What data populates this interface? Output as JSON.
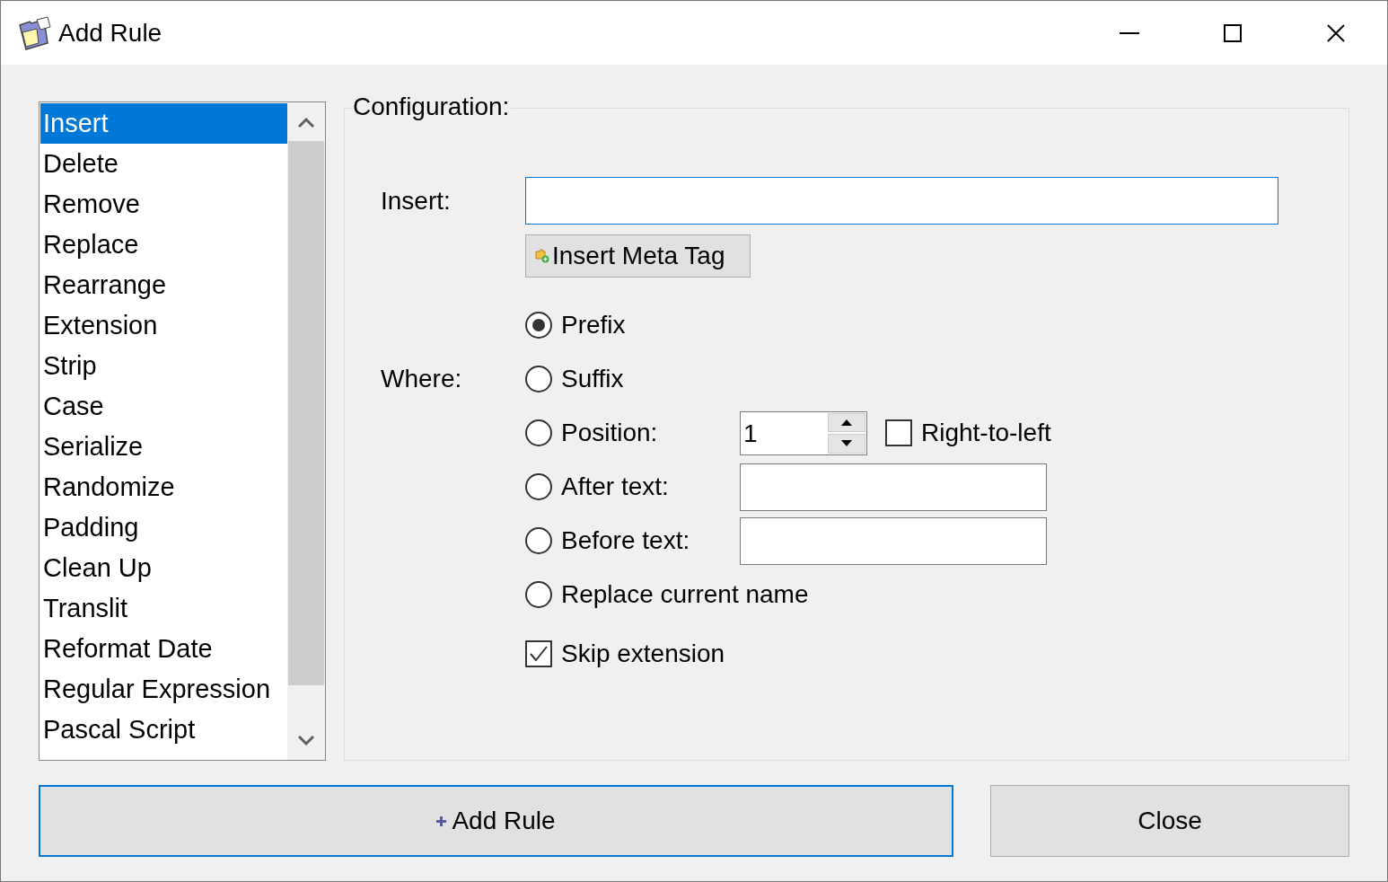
{
  "window": {
    "title": "Add Rule"
  },
  "rules": [
    {
      "label": "Insert",
      "selected": true
    },
    {
      "label": "Delete",
      "selected": false
    },
    {
      "label": "Remove",
      "selected": false
    },
    {
      "label": "Replace",
      "selected": false
    },
    {
      "label": "Rearrange",
      "selected": false
    },
    {
      "label": "Extension",
      "selected": false
    },
    {
      "label": "Strip",
      "selected": false
    },
    {
      "label": "Case",
      "selected": false
    },
    {
      "label": "Serialize",
      "selected": false
    },
    {
      "label": "Randomize",
      "selected": false
    },
    {
      "label": "Padding",
      "selected": false
    },
    {
      "label": "Clean Up",
      "selected": false
    },
    {
      "label": "Translit",
      "selected": false
    },
    {
      "label": "Reformat Date",
      "selected": false
    },
    {
      "label": "Regular Expression",
      "selected": false
    },
    {
      "label": "Pascal Script",
      "selected": false
    }
  ],
  "configuration": {
    "title": "Configuration:",
    "insert_label": "Insert:",
    "meta_tag_button": "Insert Meta Tag",
    "where_label": "Where:",
    "where_options": [
      {
        "label": "Prefix",
        "kind": "plain",
        "selected": true
      },
      {
        "label": "Suffix",
        "kind": "plain",
        "selected": false
      },
      {
        "label": "Position:",
        "kind": "spinner",
        "selected": false,
        "value": "1",
        "right_to_left": {
          "label": "Right-to-left",
          "checked": false
        }
      },
      {
        "label": "After text:",
        "kind": "text",
        "selected": false
      },
      {
        "label": "Before text:",
        "kind": "text",
        "selected": false
      },
      {
        "label": "Replace current name",
        "kind": "plain",
        "selected": false
      }
    ],
    "skip_extension": {
      "label": "Skip extension",
      "checked": true
    }
  },
  "buttons": [
    {
      "label": "Add Rule",
      "kind": "primary"
    },
    {
      "label": "Close",
      "kind": "normal"
    }
  ]
}
